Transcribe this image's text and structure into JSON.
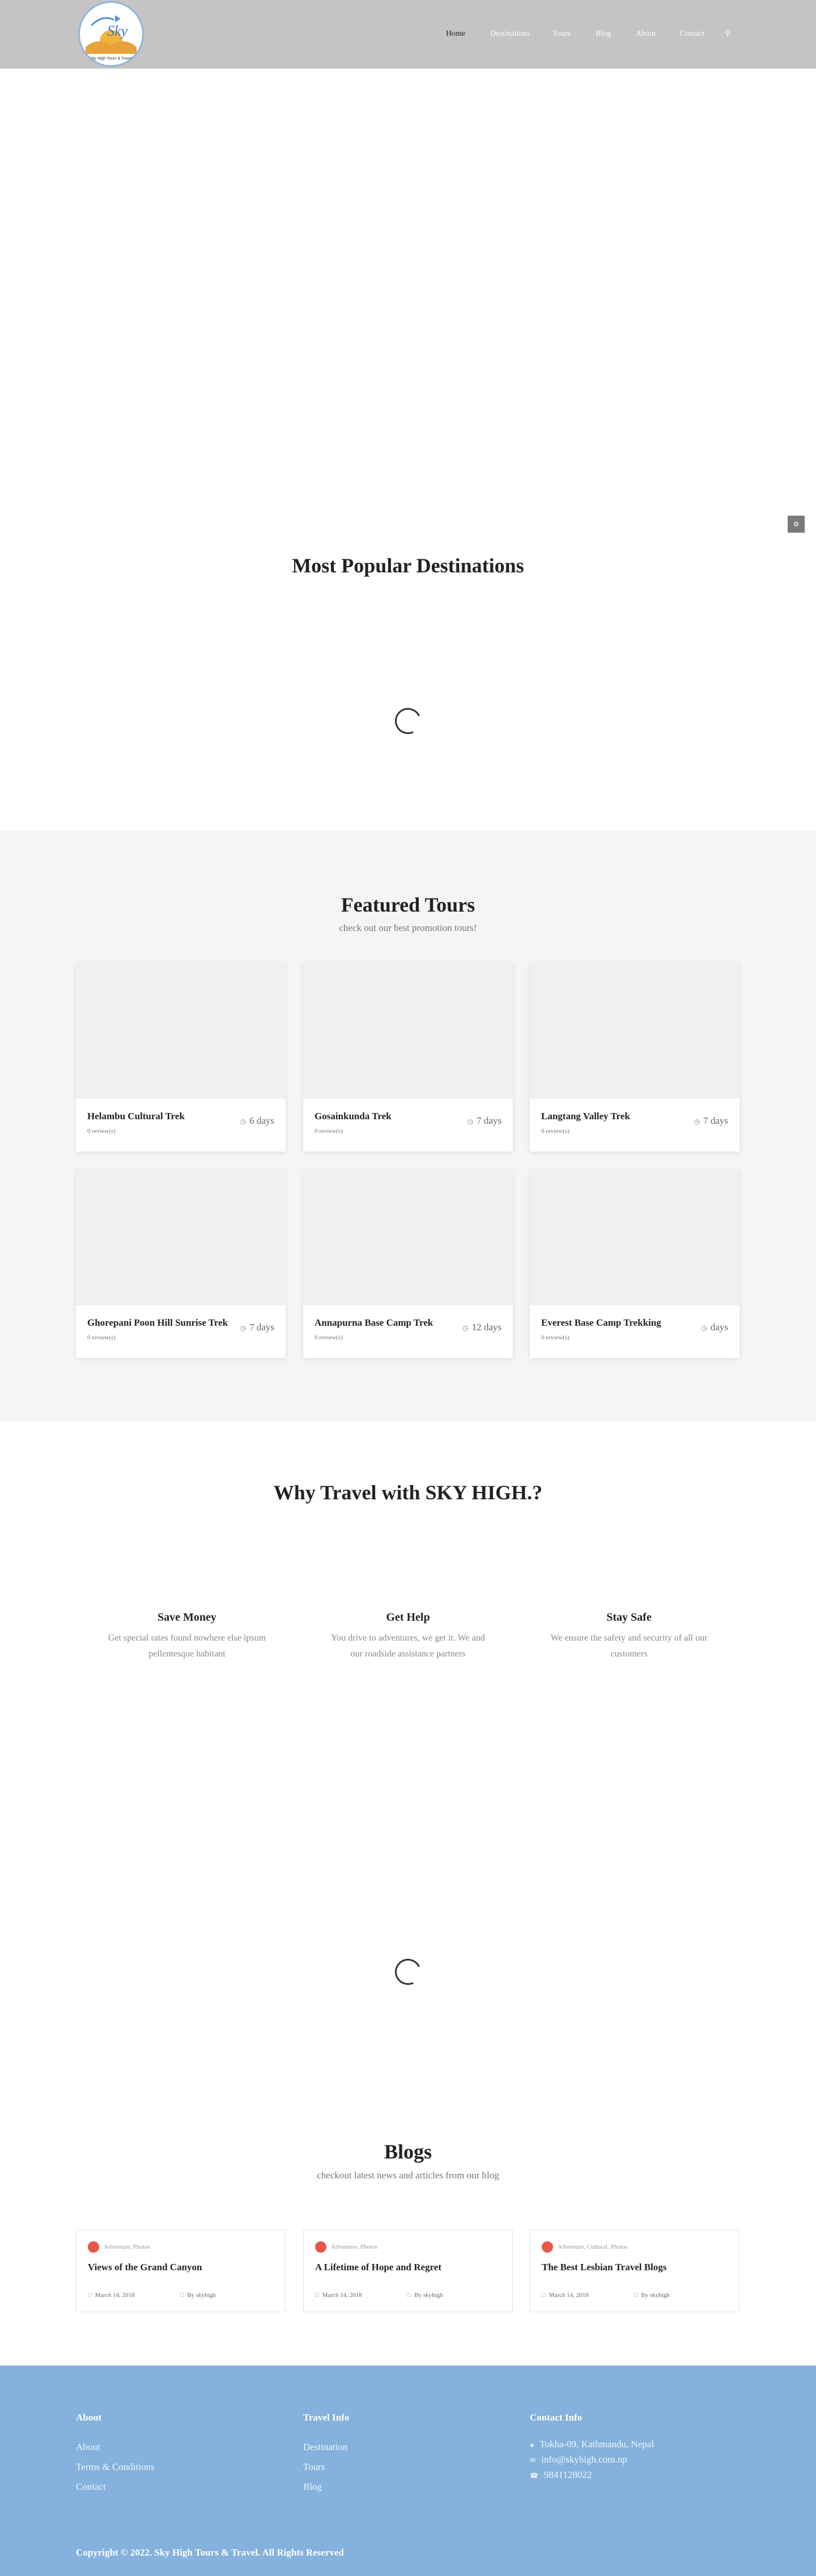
{
  "header": {
    "logo_text": "Sky",
    "logo_tagline": "Sky High Tours & Travel",
    "nav": [
      {
        "label": "Home",
        "active": true
      },
      {
        "label": "Destinations",
        "active": false
      },
      {
        "label": "Tours",
        "active": false
      },
      {
        "label": "Blog",
        "active": false
      },
      {
        "label": "About",
        "active": false
      },
      {
        "label": "Contact",
        "active": false
      }
    ],
    "search_icon": "search-icon"
  },
  "side_tab_icon": "gear-icon",
  "destinations": {
    "title": "Most Popular Destinations"
  },
  "featured": {
    "title": "Featured Tours",
    "subtitle": "check out our best promotion tours!",
    "tours": [
      {
        "name": "Helambu Cultural Trek",
        "reviews": "0 review(s)",
        "days": "6 days"
      },
      {
        "name": "Gosainkunda Trek",
        "reviews": "0 review(s)",
        "days": "7 days"
      },
      {
        "name": "Langtang Valley Trek",
        "reviews": "0 review(s)",
        "days": "7 days"
      },
      {
        "name": "Ghorepani Poon Hill Sunrise Trek",
        "reviews": "0 review(s)",
        "days": "7 days"
      },
      {
        "name": "Annapurna Base Camp Trek",
        "reviews": "0 review(s)",
        "days": "12 days"
      },
      {
        "name": "Everest Base Camp Trekking",
        "reviews": "0 review(s)",
        "days": "days"
      }
    ]
  },
  "why": {
    "title": "Why Travel with SKY HIGH.?",
    "features": [
      {
        "title": "Save Money",
        "desc": "Get special rates found nowhere else ipsum pellentesque habitant"
      },
      {
        "title": "Get Help",
        "desc": "You drive to adventures, we get it. We and our roadside assistance partners"
      },
      {
        "title": "Stay Safe",
        "desc": "We ensure the safety and security of all our customers"
      }
    ]
  },
  "blogs": {
    "title": "Blogs",
    "subtitle": "checkout latest news and articles from our blog",
    "posts": [
      {
        "categories": "Adventure, Photos",
        "title": "Views of the Grand Canyon",
        "date": "March 14, 2018",
        "author": "By skyhigh"
      },
      {
        "categories": "Adventure, Photos",
        "title": "A Lifetime of Hope and Regret",
        "date": "March 14, 2018",
        "author": "By skyhigh"
      },
      {
        "categories": "Adventure, Cultural, Photos",
        "title": "The Best Lesbian Travel Blogs",
        "date": "March 14, 2018",
        "author": "By skyhigh"
      }
    ]
  },
  "footer": {
    "about": {
      "title": "About",
      "links": [
        "About",
        "Terms & Conditions",
        "Contact"
      ]
    },
    "travel_info": {
      "title": "Travel Info",
      "links": [
        "Destination",
        "Tours",
        "Blog"
      ]
    },
    "contact": {
      "title": "Contact Info",
      "items": [
        {
          "icon": "map-marker-icon",
          "text": "Tokha-09, Kathmandu, Nepal"
        },
        {
          "icon": "envelope-icon",
          "text": "info@skyhigh.com.np"
        },
        {
          "icon": "phone-icon",
          "text": "9841128022"
        }
      ]
    },
    "copyright": "Copyright ©  2022. Sky High Tours & Travel. All Rights Reserved"
  }
}
